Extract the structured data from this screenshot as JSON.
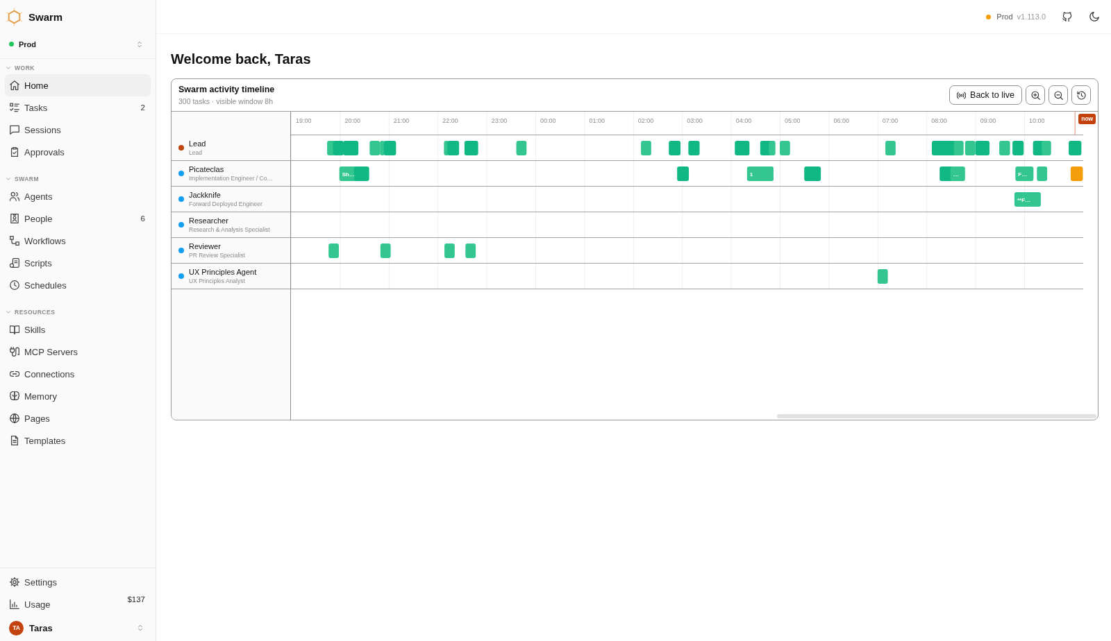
{
  "sidebar": {
    "brand": "Swarm",
    "environment": {
      "label": "Prod",
      "color": "#22c55e"
    },
    "sections": [
      {
        "title": "WORK",
        "expanded": true,
        "items": [
          {
            "label": "Home",
            "selected": true
          },
          {
            "label": "Tasks",
            "count": "2",
            "selected": false
          },
          {
            "label": "Sessions",
            "selected": false
          },
          {
            "label": "Approvals",
            "selected": false
          }
        ]
      },
      {
        "title": "SWARM",
        "expanded": true,
        "items": [
          {
            "label": "Agents",
            "selected": false
          },
          {
            "label": "People",
            "count": "6",
            "selected": false
          },
          {
            "label": "Workflows",
            "selected": false
          },
          {
            "label": "Scripts",
            "selected": false
          },
          {
            "label": "Schedules",
            "selected": false
          }
        ]
      },
      {
        "title": "RESOURCES",
        "expanded": true,
        "items": [
          {
            "label": "Skills",
            "selected": false
          },
          {
            "label": "MCP Servers",
            "selected": false
          },
          {
            "label": "Connections",
            "selected": false
          },
          {
            "label": "Memory",
            "selected": false
          },
          {
            "label": "Pages",
            "selected": false
          },
          {
            "label": "Templates",
            "selected": false
          }
        ]
      }
    ],
    "footer_items": [
      {
        "label": "Settings",
        "selected": false
      },
      {
        "label": "Usage",
        "value": "$137",
        "selected": false
      }
    ],
    "user": {
      "initials": "TA",
      "name": "Taras"
    }
  },
  "topbar": {
    "environment": {
      "label": "Prod",
      "color": "#f5a00b"
    },
    "version": "v1.113.0"
  },
  "page_title": "Welcome back, Taras",
  "timeline": {
    "title": "Swarm activity timeline",
    "subtitle": "300 tasks · visible window 8h",
    "live_button": "Back to live",
    "time_labels": [
      "19:00",
      "20:00",
      "21:00",
      "22:00",
      "23:00",
      "00:00",
      "01:00",
      "02:00",
      "03:00",
      "04:00",
      "05:00",
      "06:00",
      "07:00",
      "08:00",
      "09:00",
      "10:00"
    ],
    "now_label": "now",
    "agents": [
      {
        "name": "Lead",
        "role": "Lead",
        "color": "#c0440f"
      },
      {
        "name": "Picateclas",
        "role": "Implementation Engineer / Co…",
        "color": "#149ef0",
        "task_labels": [
          "Sh…",
          "1",
          "…",
          "F…"
        ]
      },
      {
        "name": "Jackknife",
        "role": "Forward Deployed Engineer",
        "color": "#149ef0",
        "task_labels": [
          "**F…"
        ]
      },
      {
        "name": "Researcher",
        "role": "Research & Analysis Specialist",
        "color": "#149ef0"
      },
      {
        "name": "Reviewer",
        "role": "PR Review Specialist",
        "color": "#149ef0"
      },
      {
        "name": "UX Principles Agent",
        "role": "UX Principles Analyst",
        "color": "#149ef0"
      }
    ]
  }
}
